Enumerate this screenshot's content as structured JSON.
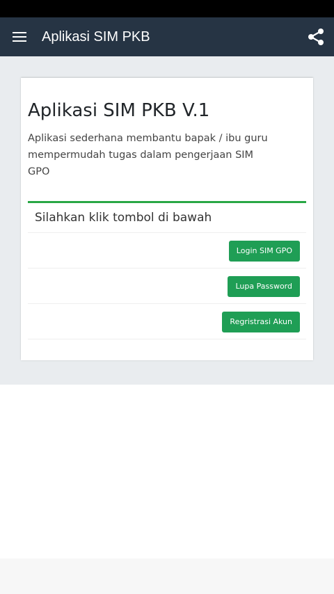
{
  "app_bar": {
    "title": "Aplikasi SIM PKB",
    "menu_icon": "hamburger-menu-icon",
    "share_icon": "share-icon",
    "background": "#263444"
  },
  "card": {
    "title": "Aplikasi SIM PKB V.1",
    "description": "Aplikasi sederhana membantu bapak / ibu guru mempermudah tugas dalam pengerjaan SIM GPO"
  },
  "list": {
    "header": "Silahkan klik tombol di bawah",
    "accent": "#28a745",
    "buttons": [
      {
        "label": "Login SIM GPO"
      },
      {
        "label": "Lupa Password"
      },
      {
        "label": "Regristrasi Akun"
      }
    ],
    "button_color": "#1f9e55"
  }
}
